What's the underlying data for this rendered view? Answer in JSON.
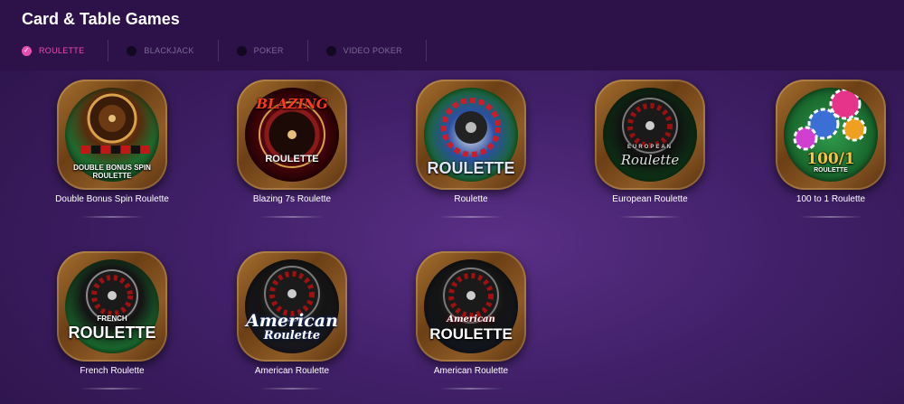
{
  "header": {
    "title": "Card & Table Games"
  },
  "tabs": [
    {
      "label": "ROULETTE",
      "active": true,
      "icon": "check-icon"
    },
    {
      "label": "BLACKJACK",
      "active": false
    },
    {
      "label": "POKER",
      "active": false
    },
    {
      "label": "VIDEO POKER",
      "active": false
    }
  ],
  "games": [
    {
      "name": "Double Bonus Spin Roulette",
      "logo": "DOUBLE BONUS SPIN ROULETTE"
    },
    {
      "name": "Blazing 7s Roulette",
      "logo": "ROULETTE",
      "logo2": "BLAZING"
    },
    {
      "name": "Roulette",
      "logo": "ROULETTE"
    },
    {
      "name": "European Roulette",
      "logo": "Roulette",
      "logo2": "EUROPEAN"
    },
    {
      "name": "100 to 1 Roulette",
      "logo": "100/1",
      "logo2": "ROULETTE"
    },
    {
      "name": "French Roulette",
      "logo": "ROULETTE",
      "logo2": "FRENCH"
    },
    {
      "name": "American Roulette",
      "logo": "American",
      "logo2": "Roulette"
    },
    {
      "name": "American Roulette",
      "logo": "ROULETTE",
      "logo2": "American"
    }
  ],
  "colors": {
    "accent": "#e84fb0",
    "header_bg": "#2c1248",
    "tile_wood": "#8e5b26"
  }
}
